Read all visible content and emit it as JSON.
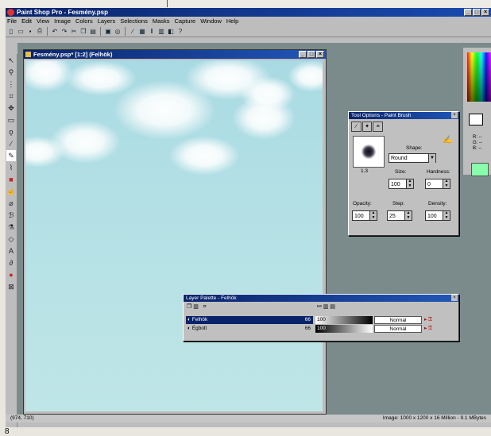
{
  "app": {
    "title": "Paint Shop Pro - Fesmény.psp",
    "window_buttons": [
      "_",
      "□",
      "×"
    ]
  },
  "menu": [
    "File",
    "Edit",
    "View",
    "Image",
    "Colors",
    "Layers",
    "Selections",
    "Masks",
    "Capture",
    "Window",
    "Help"
  ],
  "toolbar_icons": [
    "new-icon",
    "open-icon",
    "save-icon",
    "print-icon",
    "undo-icon",
    "redo-icon",
    "cut-icon",
    "copy-icon",
    "paste-icon",
    "view-icon",
    "zoom-icon",
    "brush-icon",
    "palette-icon",
    "histogram-icon",
    "layers-icon",
    "info-icon",
    "help-icon"
  ],
  "tools": [
    "arrow-icon",
    "zoom-icon",
    "deformation-icon",
    "crop-icon",
    "mover-icon",
    "selection-icon",
    "freehand-icon",
    "eyedropper-icon",
    "paintbrush-icon",
    "clone-icon",
    "color-replacer-icon",
    "retouch-icon",
    "eraser-icon",
    "picture-tube-icon",
    "airbrush-icon",
    "flood-fill-icon",
    "text-icon",
    "draw-icon",
    "preset-shapes-icon",
    "object-selector-icon"
  ],
  "document": {
    "title": "Fesmény.psp* [1:2] (Felhök)"
  },
  "color_panel": {
    "rgb_label": "R: --\nG: --\nB: --",
    "foreground": "#ffffff"
  },
  "tool_options": {
    "title": "Tool Options - Paint Brush",
    "brush_size_label": "1.3",
    "shape_label": "Shape:",
    "shape_value": "Round",
    "size_label": "Size:",
    "size_value": "100",
    "hardness_label": "Hardness:",
    "hardness_value": "0",
    "opacity_label": "Opacity:",
    "opacity_value": "100",
    "step_label": "Step:",
    "step_value": "25",
    "density_label": "Density:",
    "density_value": "100"
  },
  "layer_palette": {
    "title": "Layer Palette - Felhök",
    "layers": [
      {
        "name": "Felhök",
        "opacity": "100",
        "blend": "Normal",
        "selected": true
      },
      {
        "name": "Égbolt",
        "opacity": "100",
        "blend": "Normal",
        "selected": false
      }
    ]
  },
  "status": {
    "coords": "(974, 710)",
    "image_info": "Image: 1000 x 1200 x 16 Million - 9.1 MBytes"
  },
  "page_number": "8",
  "colors": {
    "titlebar": "#0a246a",
    "workspace": "#7b8b8b",
    "sky": "#b3e0e5"
  }
}
